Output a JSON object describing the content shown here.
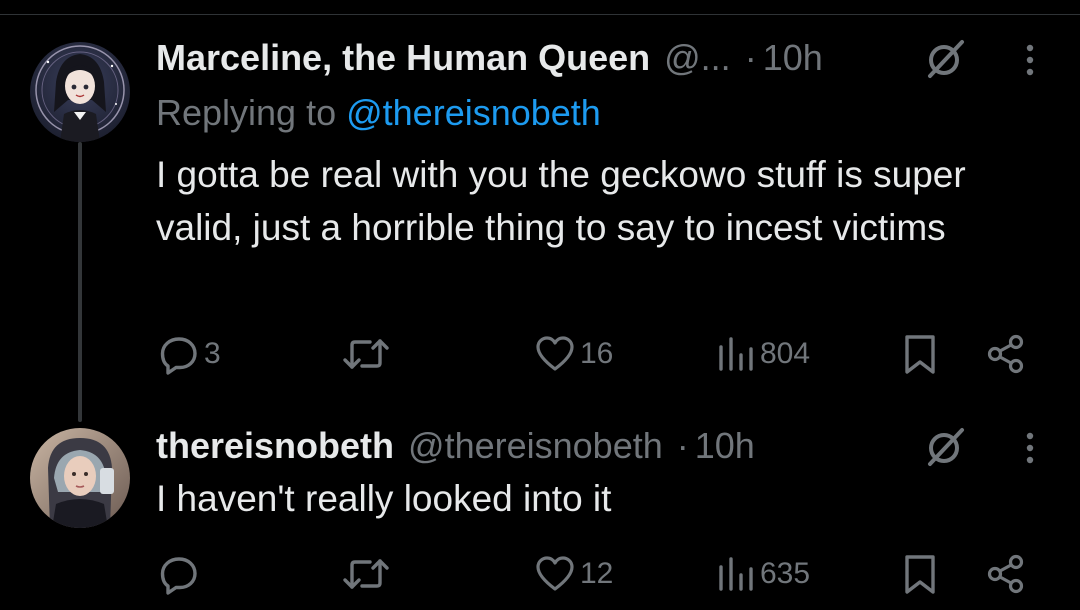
{
  "tweets": [
    {
      "display_name": "Marceline, the Human Queen",
      "handle": "@...",
      "separator": "·",
      "time": "10h",
      "replying_prefix": "Replying to ",
      "replying_to": "@thereisnobeth",
      "text": "I gotta be real with you the geckowo stuff is super valid, just a horrible thing to say to incest victims",
      "actions": {
        "replies": "3",
        "reposts": "",
        "likes": "16",
        "views": "804"
      }
    },
    {
      "display_name": "thereisnobeth",
      "handle": "@thereisnobeth",
      "separator": "·",
      "time": "10h",
      "text": "I haven't really looked into it",
      "actions": {
        "replies": "",
        "reposts": "",
        "likes": "12",
        "views": "635"
      }
    }
  ],
  "colors": {
    "background": "#000000",
    "primary_text": "#e7e9ea",
    "secondary_text": "#71767b",
    "mention": "#1d9bf0",
    "thread_line": "#333639"
  },
  "icons": {
    "reply": "reply-icon",
    "repost": "repost-icon",
    "like": "heart-icon",
    "views": "views-icon",
    "bookmark": "bookmark-icon",
    "share": "share-icon",
    "grok": "grok-icon",
    "more": "more-icon"
  }
}
